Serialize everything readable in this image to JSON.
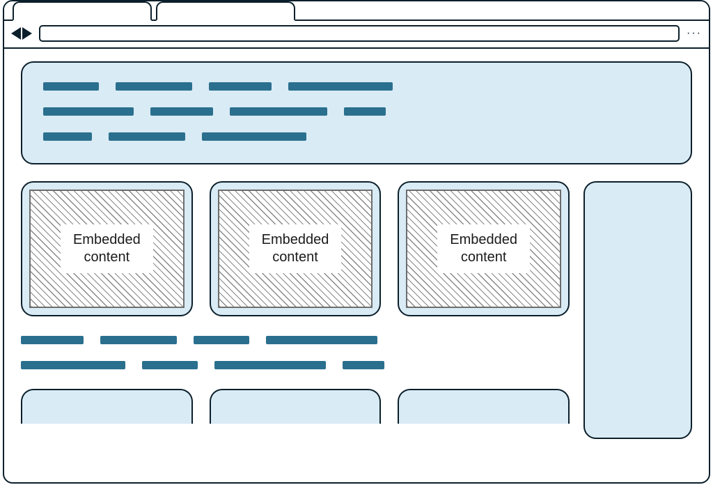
{
  "browser": {
    "tabs": [
      {
        "label": ""
      },
      {
        "label": ""
      }
    ],
    "url": "",
    "menu_glyph": "···"
  },
  "embedded": {
    "cards": [
      {
        "label": "Embedded\ncontent"
      },
      {
        "label": "Embedded\ncontent"
      },
      {
        "label": "Embedded\ncontent"
      }
    ]
  },
  "colors": {
    "panel_bg": "#d9ebf5",
    "stroke": "#0b1f2b",
    "text_bar": "#2b6f8e"
  }
}
